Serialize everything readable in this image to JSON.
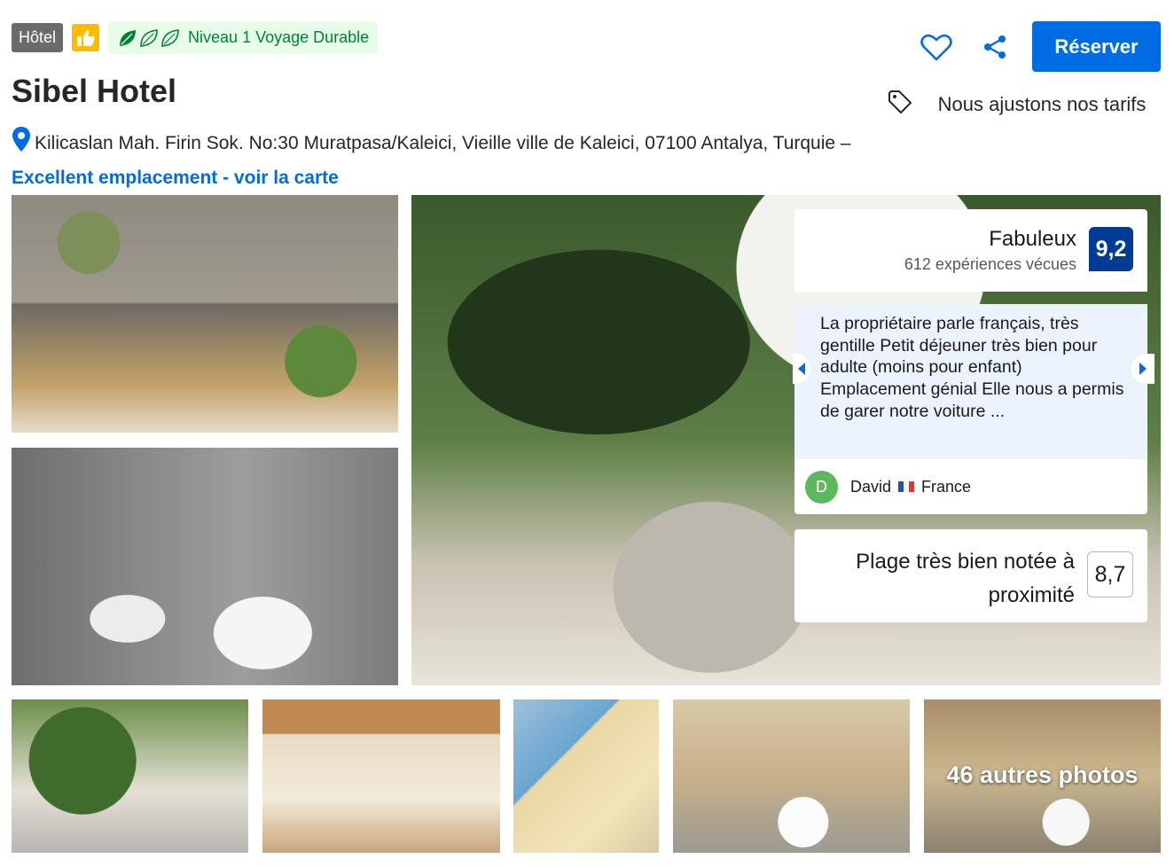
{
  "badges": {
    "property_type": "Hôtel",
    "sustainability_label": "Niveau 1 Voyage Durable"
  },
  "hotel": {
    "name": "Sibel Hotel",
    "address": "Kilicaslan Mah. Firin Sok. No:30 Muratpasa/Kaleici, Vieille ville de Kaleici, 07100 Antalya, Turquie",
    "address_separator": " – ",
    "map_link": "Excellent emplacement - voir la carte"
  },
  "actions": {
    "reserve_label": "Réserver"
  },
  "price_match": {
    "text": "Nous ajustons nos tarifs"
  },
  "rating": {
    "label": "Fabuleux",
    "count_text": "612 expériences vécues",
    "score": "9,2"
  },
  "review": {
    "text": "La propriétaire parle français, très gentille Petit déjeuner très bien pour adulte (moins pour enfant) Emplacement génial Elle nous a permis de garer notre voiture ...",
    "reviewer_initial": "D",
    "reviewer_name": "David",
    "reviewer_country": "France"
  },
  "beach": {
    "text": "Plage très bien notée à proximité",
    "score": "8,7"
  },
  "gallery": {
    "more_photos_label": "46 autres photos"
  },
  "colors": {
    "accent_blue": "#006ce4",
    "score_blue": "#003b95",
    "review_bg": "#ebf3ff",
    "sustain_green": "#008234",
    "badge_yellow": "#febb02"
  }
}
